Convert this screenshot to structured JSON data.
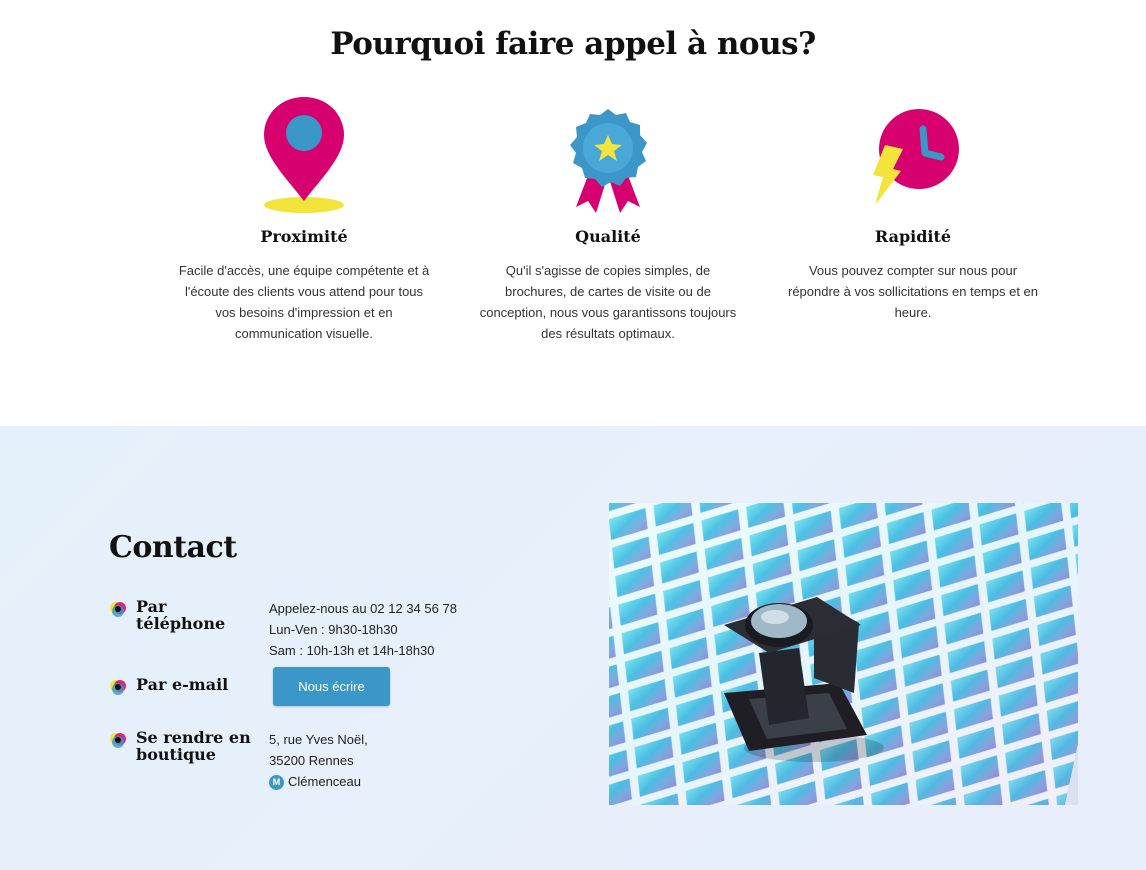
{
  "why": {
    "title": "Pourquoi faire appel à nous?",
    "features": [
      {
        "icon": "location-pin-icon",
        "title": "Proximité",
        "lines": [
          "Facile d'accès, une équipe compétente et à",
          "l'écoute des clients vous attend pour tous",
          "vos besoins d'impression et en",
          "communication visuelle."
        ]
      },
      {
        "icon": "quality-badge-icon",
        "title": "Qualité",
        "lines": [
          "Qu'il s'agisse de copies simples, de",
          "brochures, de cartes de visite ou de",
          "conception, nous vous garantissons toujours",
          "des résultats optimaux."
        ]
      },
      {
        "icon": "fast-clock-icon",
        "title": "Rapidité",
        "lines": [
          "Vous pouvez compter sur nous pour",
          "répondre à vos sollicitations en temps et en",
          "heure."
        ]
      }
    ]
  },
  "contact": {
    "title": "Contact",
    "phone": {
      "label": "Par téléphone",
      "lines": [
        "Appelez-nous au 02 12 34 56 78",
        "Lun-Ven : 9h30-18h30",
        "Sam : 10h-13h et 14h-18h30"
      ]
    },
    "email": {
      "label": "Par e-mail",
      "button": "Nous écrire"
    },
    "shop": {
      "label_line1": "Se rendre en",
      "label_line2": "boutique",
      "address1": "5, rue Yves Noël,",
      "address2": "35200 Rennes",
      "metro_badge": "M",
      "metro_station": "Clémenceau"
    }
  },
  "colors": {
    "magenta": "#d6006e",
    "cyan": "#3b97c7",
    "yellow": "#f2e43a",
    "contact_bg": "#e7f0fb"
  }
}
